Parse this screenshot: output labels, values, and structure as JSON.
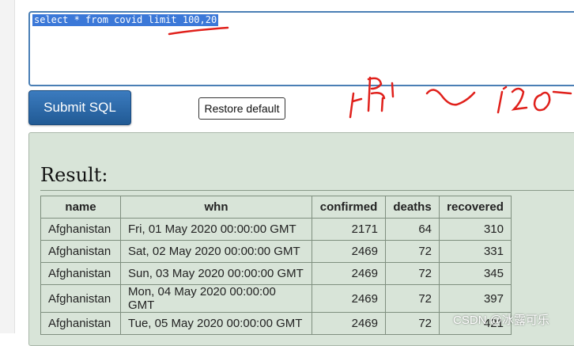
{
  "editor": {
    "query": "select * from covid limit 100,20"
  },
  "buttons": {
    "submit_label": "Submit SQL",
    "restore_label": "Restore default"
  },
  "result": {
    "title": "Result:",
    "columns": [
      "name",
      "whn",
      "confirmed",
      "deaths",
      "recovered"
    ],
    "rows": [
      [
        "Afghanistan",
        "Fri, 01 May 2020 00:00:00 GMT",
        "2171",
        "64",
        "310"
      ],
      [
        "Afghanistan",
        "Sat, 02 May 2020 00:00:00 GMT",
        "2469",
        "72",
        "331"
      ],
      [
        "Afghanistan",
        "Sun, 03 May 2020 00:00:00 GMT",
        "2469",
        "72",
        "345"
      ],
      [
        "Afghanistan",
        "Mon, 04 May 2020 00:00:00 GMT",
        "2469",
        "72",
        "397"
      ],
      [
        "Afghanistan",
        "Tue, 05 May 2020 00:00:00 GMT",
        "2469",
        "72",
        "421"
      ]
    ]
  },
  "watermark": "CSDN @冰露可乐",
  "colors": {
    "submit_button": "#2a65a5",
    "result_panel": "#d8e4d8",
    "annotation_ink": "#e0201b",
    "selection": "#3b78d8"
  }
}
